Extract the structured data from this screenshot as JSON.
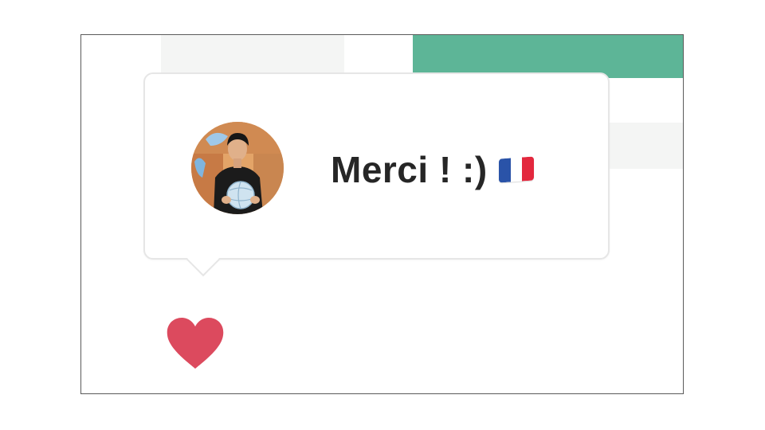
{
  "tooltip": {
    "message": "Merci ! :)",
    "flag_icon": "france-flag-icon",
    "avatar_icon": "user-avatar-photo"
  },
  "reaction": {
    "icon": "heart-icon"
  },
  "colors": {
    "accent_green": "#5db597",
    "heart_red": "#dc4a5e",
    "text": "#262626",
    "flag_blue": "#2a53a8",
    "flag_white": "#ffffff",
    "flag_red": "#e3283e"
  }
}
